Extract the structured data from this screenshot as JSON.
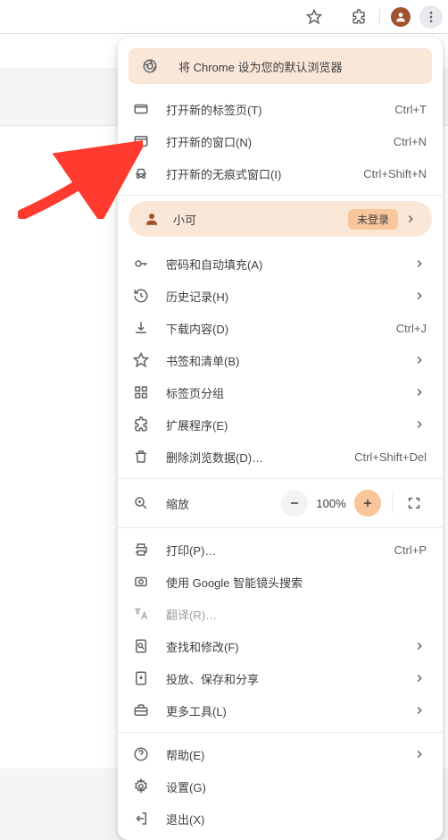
{
  "banner": {
    "text": "将 Chrome 设为您的默认浏览器"
  },
  "section_tabs": {
    "new_tab": {
      "label": "打开新的标签页(T)",
      "shortcut": "Ctrl+T"
    },
    "new_window": {
      "label": "打开新的窗口(N)",
      "shortcut": "Ctrl+N"
    },
    "incognito": {
      "label": "打开新的无痕式窗口(I)",
      "shortcut": "Ctrl+Shift+N"
    }
  },
  "profile": {
    "name": "小可",
    "status": "未登录"
  },
  "section_main": {
    "passwords": {
      "label": "密码和自动填充(A)"
    },
    "history": {
      "label": "历史记录(H)"
    },
    "downloads": {
      "label": "下载内容(D)",
      "shortcut": "Ctrl+J"
    },
    "bookmarks": {
      "label": "书签和清单(B)"
    },
    "tabgroups": {
      "label": "标签页分组"
    },
    "extensions": {
      "label": "扩展程序(E)"
    },
    "cleardata": {
      "label": "删除浏览数据(D)…",
      "shortcut": "Ctrl+Shift+Del"
    }
  },
  "zoom": {
    "label": "缩放",
    "value": "100%"
  },
  "section_tools": {
    "print": {
      "label": "打印(P)…",
      "shortcut": "Ctrl+P"
    },
    "lens": {
      "label": "使用 Google 智能镜头搜索"
    },
    "translate": {
      "label": "翻译(R)…"
    },
    "find": {
      "label": "查找和修改(F)"
    },
    "cast": {
      "label": "投放、保存和分享"
    },
    "moretools": {
      "label": "更多工具(L)"
    }
  },
  "section_footer": {
    "help": {
      "label": "帮助(E)"
    },
    "settings": {
      "label": "设置(G)"
    },
    "exit": {
      "label": "退出(X)"
    }
  }
}
